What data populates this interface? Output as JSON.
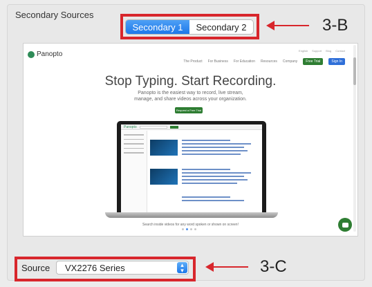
{
  "section": {
    "title": "Secondary Sources"
  },
  "tabs": [
    {
      "label": "Secondary 1",
      "active": true
    },
    {
      "label": "Secondary 2",
      "active": false
    }
  ],
  "callouts": {
    "top": "3-B",
    "bottom": "3-C",
    "color": "#d8262c"
  },
  "preview": {
    "logo": "Panopto",
    "nav_links": [
      "The Product",
      "For Business",
      "For Education",
      "Resources",
      "Company"
    ],
    "nav_buttons": [
      "Free Trial",
      "Sign In"
    ],
    "utility_links": [
      "English",
      "Support",
      "Blog",
      "Contact"
    ],
    "headline": "Stop Typing. Start Recording.",
    "subtext_line1": "Panopto is the easiest way to record, live stream,",
    "subtext_line2": "manage, and share videos across your organization.",
    "cta": "Request a Free Trial",
    "screen_logo": "Panopto",
    "caption": "Search inside videos for any word spoken or shown on screen!"
  },
  "source": {
    "label": "Source",
    "selected": "VX2276 Series"
  }
}
